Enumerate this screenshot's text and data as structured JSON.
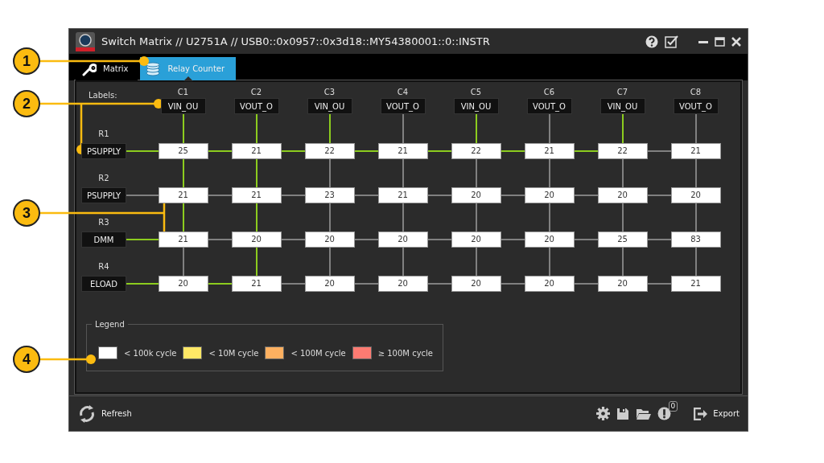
{
  "window": {
    "title": "Switch Matrix // U2751A // USB0::0x0957::0x3d18::MY54380001::0::INSTR"
  },
  "tabs": [
    {
      "label": "Matrix",
      "selected": false
    },
    {
      "label": "Relay Counter",
      "selected": true
    }
  ],
  "matrix": {
    "labels_caption": "Labels:",
    "columns": [
      {
        "name": "C1",
        "label": "VIN_OU",
        "links": [
          true,
          true,
          true,
          false
        ]
      },
      {
        "name": "C2",
        "label": "VOUT_O",
        "links": [
          true,
          true,
          true,
          true
        ]
      },
      {
        "name": "C3",
        "label": "VIN_OU",
        "links": [
          true,
          false,
          false,
          false
        ]
      },
      {
        "name": "C4",
        "label": "VOUT_O",
        "links": [
          false,
          false,
          false,
          false
        ]
      },
      {
        "name": "C5",
        "label": "VIN_OU",
        "links": [
          true,
          false,
          false,
          false
        ]
      },
      {
        "name": "C6",
        "label": "VOUT_O",
        "links": [
          false,
          false,
          false,
          false
        ]
      },
      {
        "name": "C7",
        "label": "VIN_OU",
        "links": [
          true,
          false,
          false,
          false
        ]
      },
      {
        "name": "C8",
        "label": "VOUT_O",
        "links": [
          false,
          false,
          false,
          false
        ]
      }
    ],
    "rows": [
      {
        "name": "R1",
        "label": "PSUPPLY",
        "links": [
          true,
          true,
          true,
          true,
          true,
          true,
          true,
          false
        ],
        "counts": [
          "25",
          "21",
          "22",
          "21",
          "22",
          "21",
          "22",
          "21"
        ]
      },
      {
        "name": "R2",
        "label": "PSUPPLY",
        "links": [
          false,
          false,
          false,
          false,
          false,
          false,
          false,
          false
        ],
        "counts": [
          "21",
          "21",
          "23",
          "21",
          "20",
          "20",
          "20",
          "20"
        ]
      },
      {
        "name": "R3",
        "label": "DMM",
        "links": [
          true,
          false,
          false,
          false,
          false,
          false,
          false,
          false
        ],
        "counts": [
          "21",
          "20",
          "20",
          "20",
          "20",
          "20",
          "25",
          "83"
        ]
      },
      {
        "name": "R4",
        "label": "ELOAD",
        "links": [
          true,
          true,
          false,
          false,
          false,
          false,
          false,
          false
        ],
        "counts": [
          "20",
          "21",
          "20",
          "20",
          "20",
          "20",
          "20",
          "21"
        ]
      }
    ]
  },
  "legend": {
    "title": "Legend",
    "items": [
      {
        "label": "< 100k cycle",
        "color": "#ffffff"
      },
      {
        "label": "< 10M cycle",
        "color": "#ffe866"
      },
      {
        "label": "< 100M cycle",
        "color": "#fdb060"
      },
      {
        "label": "≥ 100M cycle",
        "color": "#fd7b72"
      }
    ]
  },
  "bottom_bar": {
    "refresh": "Refresh",
    "alerts_count": "0",
    "export": "Export"
  },
  "callouts": [
    "1",
    "2",
    "3",
    "4"
  ]
}
